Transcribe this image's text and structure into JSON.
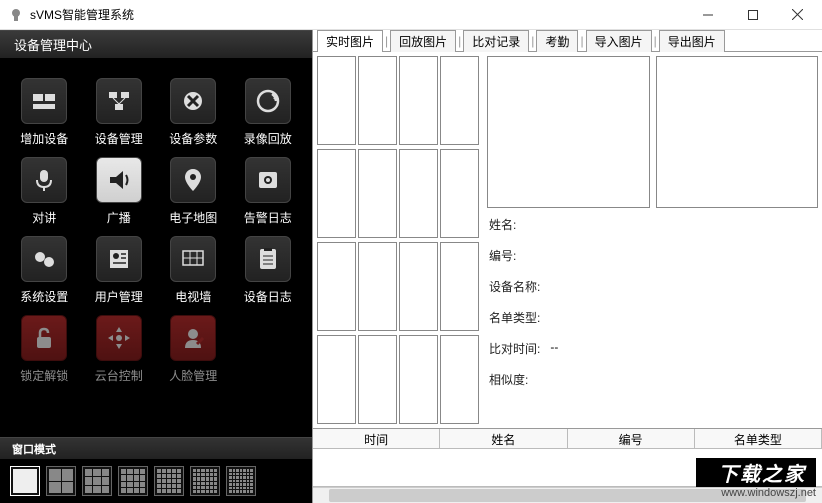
{
  "window": {
    "title": "sVMS智能管理系统"
  },
  "sidebar": {
    "header": "设备管理中心",
    "items": [
      {
        "label": "增加设备",
        "icon": "add-device"
      },
      {
        "label": "设备管理",
        "icon": "device-mgmt"
      },
      {
        "label": "设备参数",
        "icon": "device-params"
      },
      {
        "label": "录像回放",
        "icon": "playback"
      },
      {
        "label": "对讲",
        "icon": "intercom"
      },
      {
        "label": "广播",
        "icon": "broadcast",
        "active": true
      },
      {
        "label": "电子地图",
        "icon": "emap"
      },
      {
        "label": "告警日志",
        "icon": "alarm-log"
      },
      {
        "label": "系统设置",
        "icon": "sys-settings"
      },
      {
        "label": "用户管理",
        "icon": "user-mgmt"
      },
      {
        "label": "电视墙",
        "icon": "tv-wall"
      },
      {
        "label": "设备日志",
        "icon": "device-log"
      },
      {
        "label": "锁定解锁",
        "icon": "lock",
        "red": true,
        "inactive": true
      },
      {
        "label": "云台控制",
        "icon": "ptz",
        "red": true,
        "inactive": true
      },
      {
        "label": "人脸管理",
        "icon": "face-mgmt",
        "red": true,
        "inactive": true
      }
    ],
    "window_mode_header": "窗口模式"
  },
  "tabs": [
    "实时图片",
    "回放图片",
    "比对记录",
    "考勤",
    "导入图片",
    "导出图片"
  ],
  "details": {
    "name_label": "姓名:",
    "id_label": "编号:",
    "device_name_label": "设备名称:",
    "list_type_label": "名单类型:",
    "compare_time_label": "比对时间:",
    "compare_time_value": "--",
    "similarity_label": "相似度:"
  },
  "columns": [
    "时间",
    "姓名",
    "编号",
    "名单类型"
  ],
  "watermark": {
    "top": "下载之家",
    "bottom": "www.windowszj.net"
  }
}
